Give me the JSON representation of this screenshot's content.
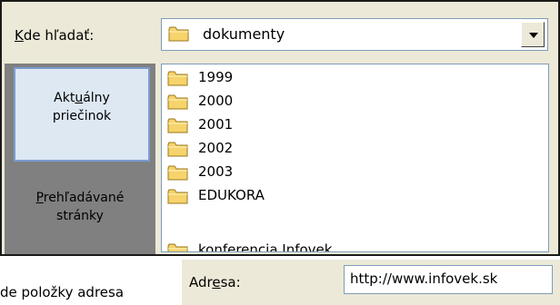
{
  "dialog": {
    "lookin": {
      "prefix": "K",
      "rest": "de hľadať:"
    },
    "combo": {
      "value": "dokumenty",
      "folder_icon": "folder-icon",
      "dropdown_icon": "chevron-down-icon"
    },
    "places": [
      {
        "before": "Akt",
        "key": "u",
        "after": "álny",
        "line2": "priečinok"
      },
      {
        "before": "",
        "key": "P",
        "after": "rehľadávané",
        "line2": "stránky"
      }
    ],
    "files": [
      "1999",
      "2000",
      "2001",
      "2002",
      "2003",
      "EDUKORA",
      "konferencia Infovek"
    ]
  },
  "background_text": "de položky adresa",
  "address": {
    "label_before": "Adr",
    "label_key": "e",
    "label_after": "sa:",
    "value": "http://www.infovek.sk"
  }
}
